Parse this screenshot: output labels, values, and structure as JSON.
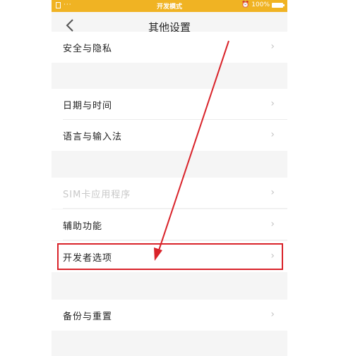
{
  "status_bar": {
    "dots": "···",
    "mode": "开发模式",
    "battery": "100%",
    "bg_color": "#f0b323"
  },
  "header": {
    "back_icon": "chevron-left-icon",
    "title": "其他设置"
  },
  "settings": {
    "security": "安全与隐私",
    "datetime": "日期与时间",
    "language": "语言与输入法",
    "sim_apps": "SIM卡应用程序",
    "accessibility": "辅助功能",
    "developer": "开发者选项",
    "backup": "备份与重置"
  },
  "chevron": "›",
  "annotation_color": "#d9232a"
}
